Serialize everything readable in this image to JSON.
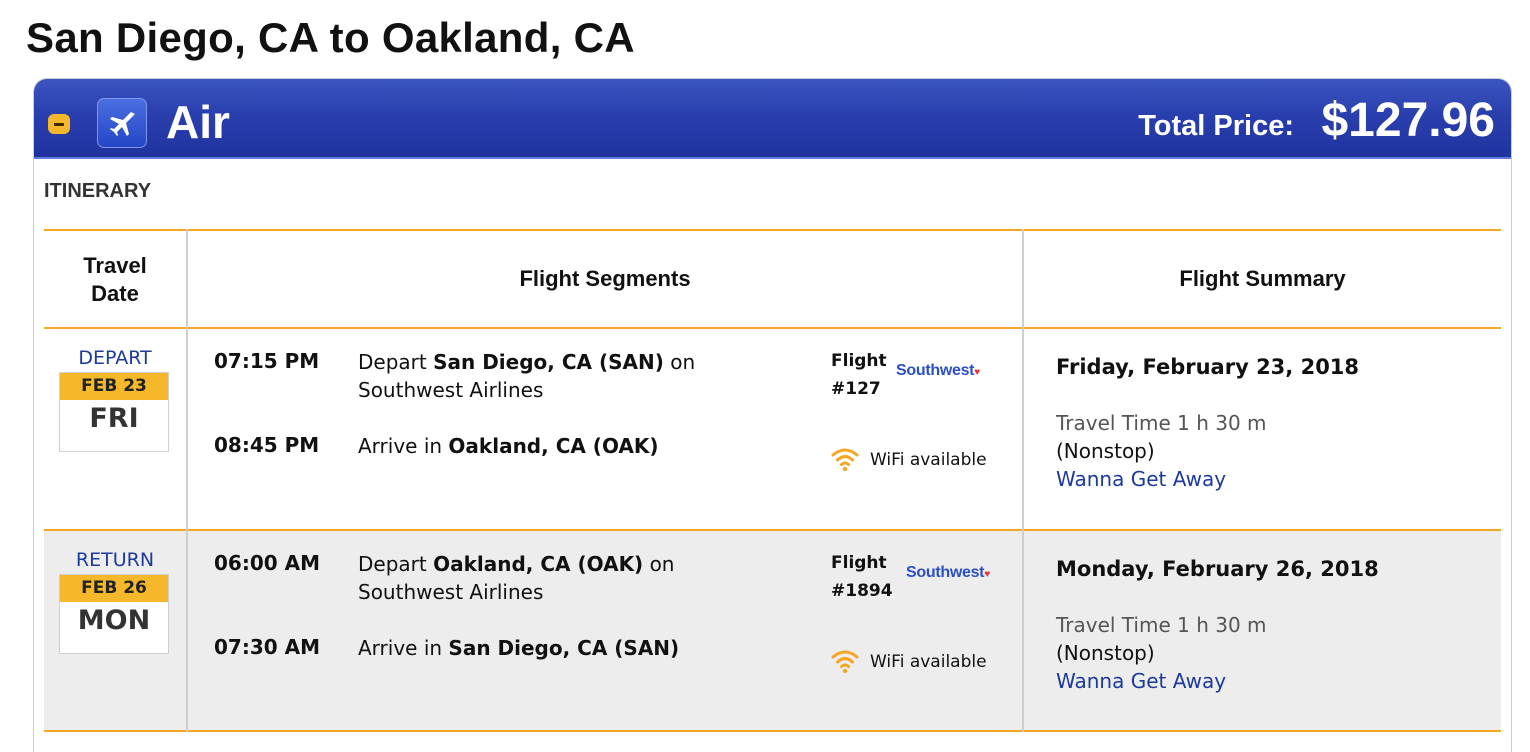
{
  "page_title": "San Diego, CA to Oakland, CA",
  "panel": {
    "section_title": "Air",
    "total_price_label": "Total Price:",
    "total_price_value": "$127.96"
  },
  "itinerary_label": "ITINERARY",
  "table": {
    "headers": [
      "Travel\nDate",
      "Flight Segments",
      "Flight Summary"
    ],
    "rows": [
      {
        "direction": "DEPART",
        "date": "FEB 23",
        "day": "FRI",
        "segments": [
          {
            "time": "07:15 PM",
            "action": "Depart",
            "place": "San Diego, CA (SAN)",
            "suffix": "on",
            "carrier": "Southwest Airlines"
          },
          {
            "time": "08:45 PM",
            "action": "Arrive in",
            "place": "Oakland, CA (OAK)"
          }
        ],
        "flight_label": "Flight",
        "flight_number": "#127",
        "airline_logo": "Southwest",
        "wifi_label": "WiFi available",
        "summary_date": "Friday, February 23, 2018",
        "travel_time": "Travel Time 1 h 30 m",
        "stops": "(Nonstop)",
        "fare": "Wanna Get Away"
      },
      {
        "direction": "RETURN",
        "date": "FEB 26",
        "day": "MON",
        "segments": [
          {
            "time": "06:00 AM",
            "action": "Depart",
            "place": "Oakland, CA (OAK)",
            "suffix": "on",
            "carrier": "Southwest Airlines"
          },
          {
            "time": "07:30 AM",
            "action": "Arrive in",
            "place": "San Diego, CA (SAN)"
          }
        ],
        "flight_label": "Flight",
        "flight_number": "#1894",
        "airline_logo": "Southwest",
        "wifi_label": "WiFi available",
        "summary_date": "Monday, February 26, 2018",
        "travel_time": "Travel Time 1 h 30 m",
        "stops": "(Nonstop)",
        "fare": "Wanna Get Away"
      }
    ]
  },
  "icons": {
    "collapse": "minus-icon",
    "air": "airplane-icon",
    "wifi": "wifi-icon"
  },
  "colors": {
    "header_blue": "#2a3fae",
    "accent_orange": "#f5a623",
    "date_yellow": "#f5b82a",
    "link_blue": "#1c3a9c"
  }
}
